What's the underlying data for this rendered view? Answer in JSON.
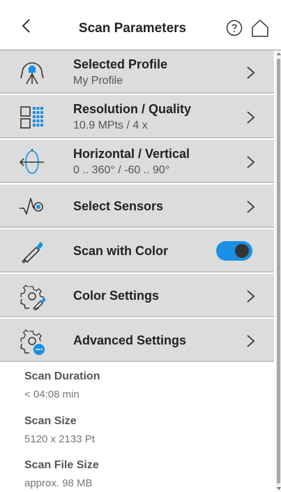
{
  "header": {
    "title": "Scan Parameters",
    "back_icon": "chevron-left-icon",
    "help_icon": "help-circle-icon",
    "home_icon": "home-icon"
  },
  "rows": [
    {
      "title": "Selected Profile",
      "subtitle": "My Profile",
      "icon": "scanner-tripod-icon"
    },
    {
      "title": "Resolution / Quality",
      "subtitle": "10.9 MPts / 4 x",
      "icon": "resolution-grid-icon"
    },
    {
      "title": "Horizontal / Vertical",
      "subtitle": "0 .. 360° / -60 .. 90°",
      "icon": "rotation-axis-icon"
    },
    {
      "title": "Select Sensors",
      "icon": "sensor-signal-icon"
    },
    {
      "title": "Scan with Color",
      "icon": "color-dropper-icon",
      "toggle_on": true
    },
    {
      "title": "Color Settings",
      "icon": "gear-dropper-icon"
    },
    {
      "title": "Advanced Settings",
      "icon": "gear-more-icon"
    }
  ],
  "info": [
    {
      "label": "Scan Duration",
      "value": "< 04:08 min"
    },
    {
      "label": "Scan Size",
      "value": "5120 x 2133 Pt"
    },
    {
      "label": "Scan File Size",
      "value": "approx. 98 MB"
    }
  ],
  "colors": {
    "accent": "#1a8fe3",
    "row_bg": "#dcdcdc",
    "toggle_knob": "#333333"
  }
}
